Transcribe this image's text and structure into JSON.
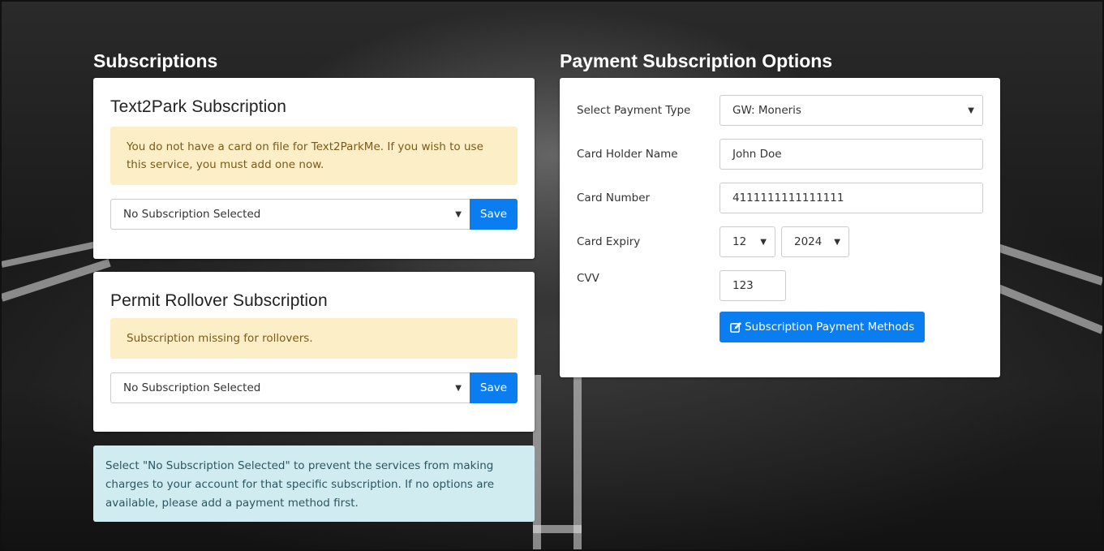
{
  "left": {
    "title": "Subscriptions",
    "text2park": {
      "title": "Text2Park Subscription",
      "warning": "You do not have a card on file for Text2ParkMe. If you wish to use this service, you must add one now.",
      "select_value": "No Subscription Selected",
      "save_label": "Save"
    },
    "rollover": {
      "title": "Permit Rollover Subscription",
      "warning": "Subscription missing for rollovers.",
      "select_value": "No Subscription Selected",
      "save_label": "Save"
    },
    "info": "Select \"No Subscription Selected\" to prevent the services from making charges to your account for that specific subscription. If no options are available, please add a payment method first."
  },
  "right": {
    "title": "Payment Subscription Options",
    "payment_type": {
      "label": "Select Payment Type",
      "value": "GW: Moneris"
    },
    "holder": {
      "label": "Card Holder Name",
      "value": "John Doe"
    },
    "number": {
      "label": "Card Number",
      "value": "4111111111111111"
    },
    "expiry": {
      "label": "Card Expiry",
      "month": "12",
      "year": "2024"
    },
    "cvv": {
      "label": "CVV",
      "value": "123"
    },
    "methods_button": "Subscription Payment Methods"
  },
  "icons": {
    "dropdown": "caret-down-icon",
    "edit": "edit-icon"
  },
  "colors": {
    "primary": "#0a7ef0",
    "warning_bg": "#fcefc8",
    "info_bg": "#d1ecf1"
  }
}
